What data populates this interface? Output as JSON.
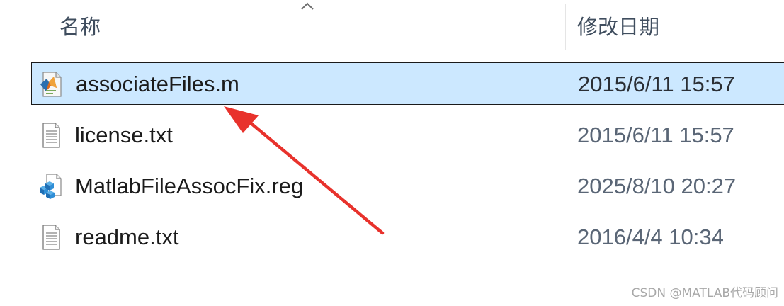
{
  "header": {
    "name_label": "名称",
    "date_label": "修改日期"
  },
  "files": [
    {
      "name": "associateFiles.m",
      "modified": "2015/6/11 15:57",
      "icon": "matlab-m-file-icon",
      "selected": true
    },
    {
      "name": "license.txt",
      "modified": "2015/6/11 15:57",
      "icon": "text-file-icon",
      "selected": false
    },
    {
      "name": "MatlabFileAssocFix.reg",
      "modified": "2025/8/10 20:27",
      "icon": "registry-file-icon",
      "selected": false
    },
    {
      "name": "readme.txt",
      "modified": "2016/4/4 10:34",
      "icon": "text-file-icon",
      "selected": false
    }
  ],
  "annotation": {
    "arrow_color": "#e8322c"
  },
  "watermark": "CSDN @MATLAB代码顾问",
  "colors": {
    "selection_bg": "#cce8ff",
    "header_text": "#3f4d5e",
    "date_text": "#5a6676"
  }
}
